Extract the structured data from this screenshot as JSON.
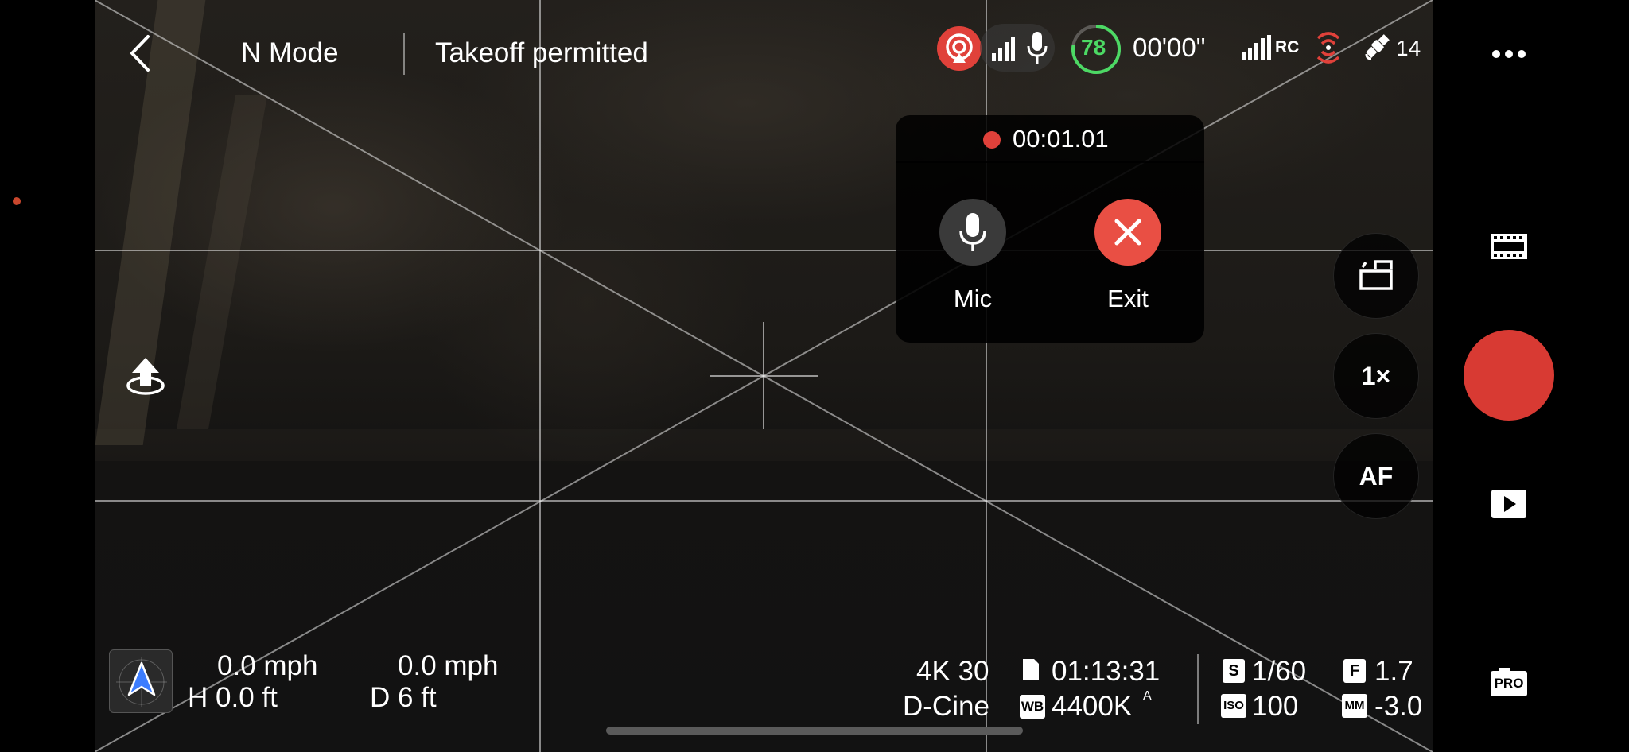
{
  "header": {
    "mode": "N Mode",
    "status": "Takeoff permitted"
  },
  "status_bar": {
    "battery_percent": "78",
    "flight_time": "00'00\"",
    "rc_label": "RC",
    "satellite_count": "14",
    "battery_color": "#4cd964",
    "live_color": "#e0413a"
  },
  "recording_popup": {
    "timer": "00:01.01",
    "mic_label": "Mic",
    "exit_label": "Exit",
    "exit_color": "#e94f44"
  },
  "side_controls": {
    "zoom": "1×",
    "focus": "AF"
  },
  "telemetry": {
    "horizontal_speed": "0.0 mph",
    "vertical_speed": "0.0 mph",
    "height": "H 0.0 ft",
    "distance": "D 6 ft"
  },
  "camera_settings": {
    "resolution_fps": "4K 30",
    "storage_time": "01:13:31",
    "color_profile": "D-Cine",
    "white_balance": "4400K",
    "wb_mode": "A",
    "shutter_label": "S",
    "shutter": "1/60",
    "aperture_label": "F",
    "aperture": "1.7",
    "iso_label": "ISO",
    "iso": "100",
    "ev_label": "MM",
    "ev": "-3.0",
    "wb_label": "WB"
  },
  "right_panel": {
    "pro_label": "PRO",
    "record_color": "#d83a33"
  }
}
